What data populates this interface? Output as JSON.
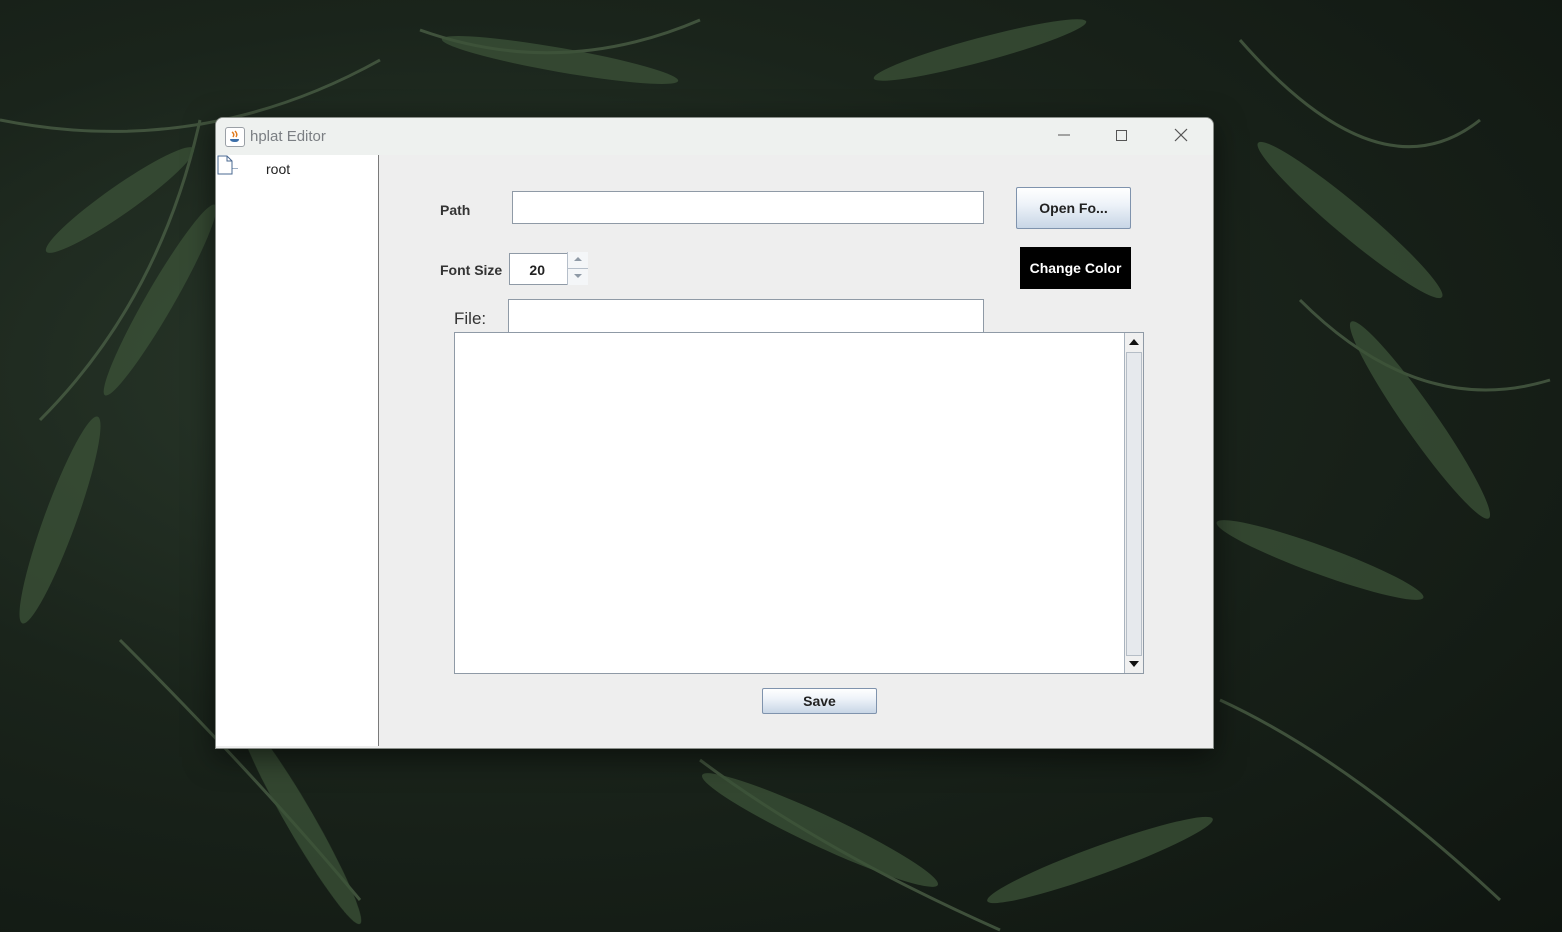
{
  "window": {
    "title": "hplat Editor",
    "controls": {
      "minimize_icon": "minimize-icon",
      "maximize_icon": "maximize-icon",
      "close_icon": "close-icon"
    }
  },
  "tree": {
    "root_label": "root",
    "root_icon": "file-icon"
  },
  "form": {
    "path_label": "Path",
    "path_value": "",
    "open_button_label": "Open Fo...",
    "font_size_label": "Font Size",
    "font_size_value": "20",
    "change_color_label": "Change Color",
    "file_label": "File:",
    "file_value": "",
    "editor_content": "",
    "save_button_label": "Save"
  },
  "colors": {
    "change_color_button_bg": "#000000",
    "change_color_button_text": "#ffffff",
    "window_bg": "#eeeeee"
  }
}
